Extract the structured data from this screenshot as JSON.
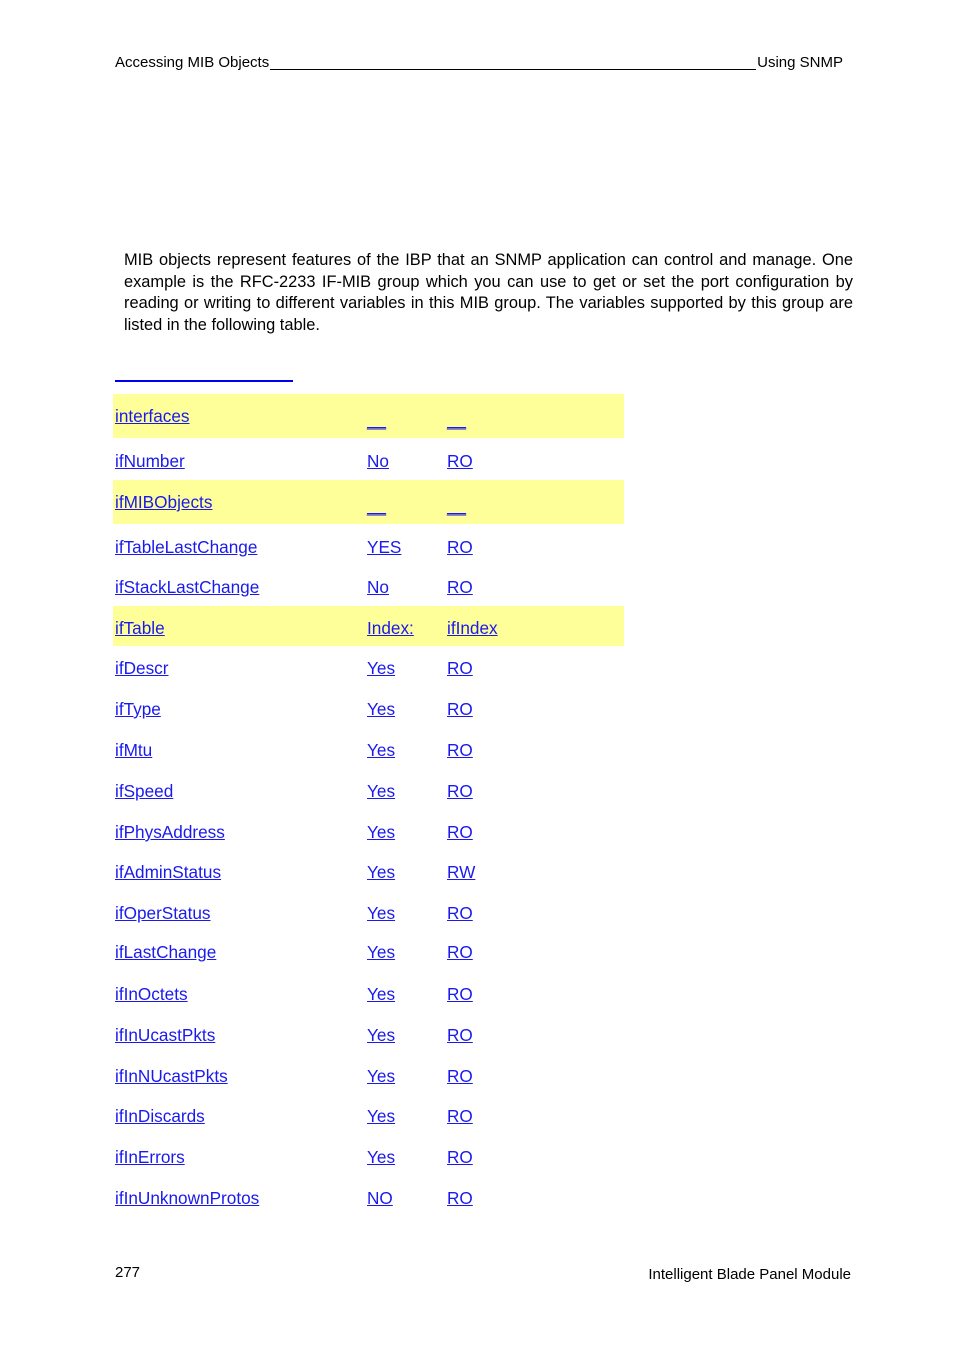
{
  "header": {
    "left": "Accessing MIB Objects",
    "right": "Using SNMP"
  },
  "intro": "MIB objects represent features of the IBP that an SNMP application can control and manage. One example is the RFC-2233 IF-MIB group which you can use to get or set the port configuration by reading or writing to different variables in this MIB group. The variables supported by this group are listed in the following table.",
  "colors": {
    "link": "#1a1aee",
    "highlight_row": "#ffff99"
  },
  "table": {
    "rows": [
      {
        "name": "interfaces",
        "supported": "__",
        "access": "__",
        "highlight": true
      },
      {
        "name": "ifNumber",
        "supported": "No",
        "access": "RO",
        "highlight": false
      },
      {
        "name": "ifMIBObjects",
        "supported": "__",
        "access": "__",
        "highlight": true
      },
      {
        "name": "ifTableLastChange",
        "supported": "YES",
        "access": "RO",
        "highlight": false
      },
      {
        "name": "ifStackLastChange",
        "supported": "No",
        "access": "RO",
        "highlight": false
      },
      {
        "name": "ifTable",
        "supported": "Index:",
        "access": "ifIndex",
        "highlight": true
      },
      {
        "name": "ifDescr",
        "supported": "Yes",
        "access": "RO",
        "highlight": false
      },
      {
        "name": "ifType",
        "supported": "Yes",
        "access": "RO",
        "highlight": false
      },
      {
        "name": "ifMtu",
        "supported": "Yes",
        "access": "RO",
        "highlight": false
      },
      {
        "name": "ifSpeed",
        "supported": "Yes",
        "access": "RO",
        "highlight": false
      },
      {
        "name": "ifPhysAddress",
        "supported": "Yes",
        "access": "RO",
        "highlight": false
      },
      {
        "name": "ifAdminStatus",
        "supported": "Yes",
        "access": "RW",
        "highlight": false
      },
      {
        "name": "ifOperStatus",
        "supported": "Yes",
        "access": "RO",
        "highlight": false
      },
      {
        "name": "ifLastChange",
        "supported": "Yes",
        "access": "RO",
        "highlight": false
      },
      {
        "name": "ifInOctets",
        "supported": "Yes",
        "access": "RO",
        "highlight": false
      },
      {
        "name": "ifInUcastPkts",
        "supported": "Yes",
        "access": "RO",
        "highlight": false
      },
      {
        "name": "ifInNUcastPkts",
        "supported": "Yes",
        "access": "RO",
        "highlight": false
      },
      {
        "name": "ifInDiscards",
        "supported": "Yes",
        "access": "RO",
        "highlight": false
      },
      {
        "name": "ifInErrors",
        "supported": "Yes",
        "access": "RO",
        "highlight": false
      },
      {
        "name": "ifInUnknownProtos",
        "supported": "NO",
        "access": "RO",
        "highlight": false
      }
    ]
  },
  "footer": {
    "page_number": "277",
    "product": "Intelligent Blade Panel Module"
  }
}
